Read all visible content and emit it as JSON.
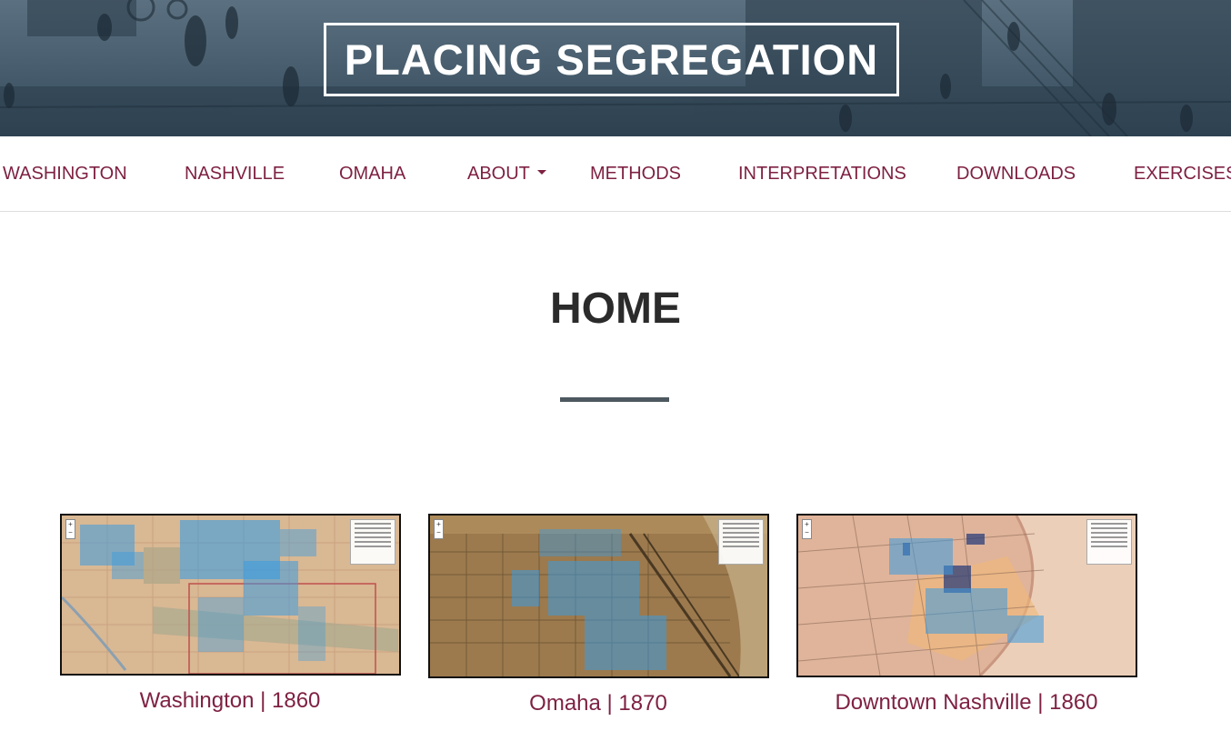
{
  "site": {
    "title": "PLACING SEGREGATION"
  },
  "nav": {
    "items": [
      {
        "label": "WASHINGTON"
      },
      {
        "label": "NASHVILLE"
      },
      {
        "label": "OMAHA"
      },
      {
        "label": "ABOUT"
      },
      {
        "label": "METHODS"
      },
      {
        "label": "INTERPRETATIONS"
      },
      {
        "label": "DOWNLOADS"
      },
      {
        "label": "EXERCISES"
      }
    ]
  },
  "page": {
    "heading": "HOME"
  },
  "cards": [
    {
      "caption": "Washington | 1860"
    },
    {
      "caption": "Omaha | 1870"
    },
    {
      "caption": "Downtown Nashville | 1860"
    }
  ],
  "colors": {
    "accent": "#7e2143",
    "heading": "#2b2b2b",
    "divider": "#4d5860",
    "hero": "#3f5565",
    "map_dots": "#3a9be0"
  }
}
